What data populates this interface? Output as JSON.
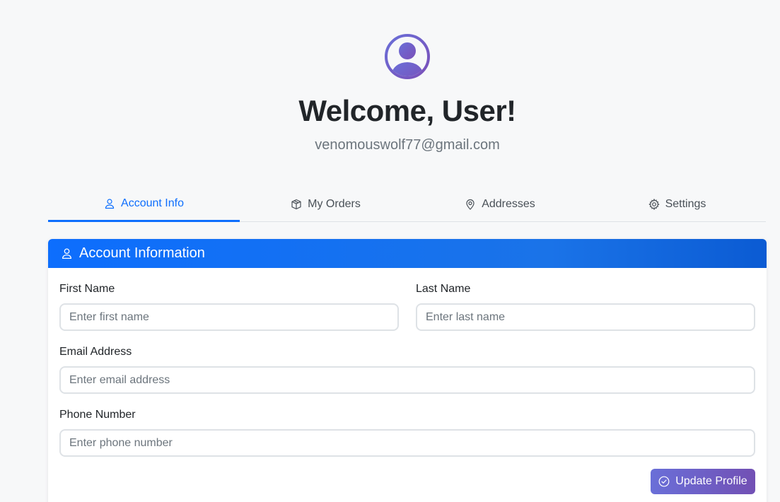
{
  "profile": {
    "welcome": "Welcome, User!",
    "email": "venomouswolf77@gmail.com"
  },
  "tabs": [
    {
      "label": "Account Info",
      "icon": "person-icon",
      "active": true
    },
    {
      "label": "My Orders",
      "icon": "box-icon",
      "active": false
    },
    {
      "label": "Addresses",
      "icon": "location-pin-icon",
      "active": false
    },
    {
      "label": "Settings",
      "icon": "gear-icon",
      "active": false
    }
  ],
  "card": {
    "title": "Account Information",
    "first_name": {
      "label": "First Name",
      "placeholder": "Enter first name"
    },
    "last_name": {
      "label": "Last Name",
      "placeholder": "Enter last name"
    },
    "email": {
      "label": "Email Address",
      "placeholder": "Enter email address"
    },
    "phone": {
      "label": "Phone Number",
      "placeholder": "Enter phone number"
    },
    "submit_label": "Update Profile"
  },
  "colors": {
    "accent": "#0d6efd",
    "button_start": "#6a6fd8",
    "button_end": "#7250b4",
    "avatar": "#7a5fd0"
  }
}
